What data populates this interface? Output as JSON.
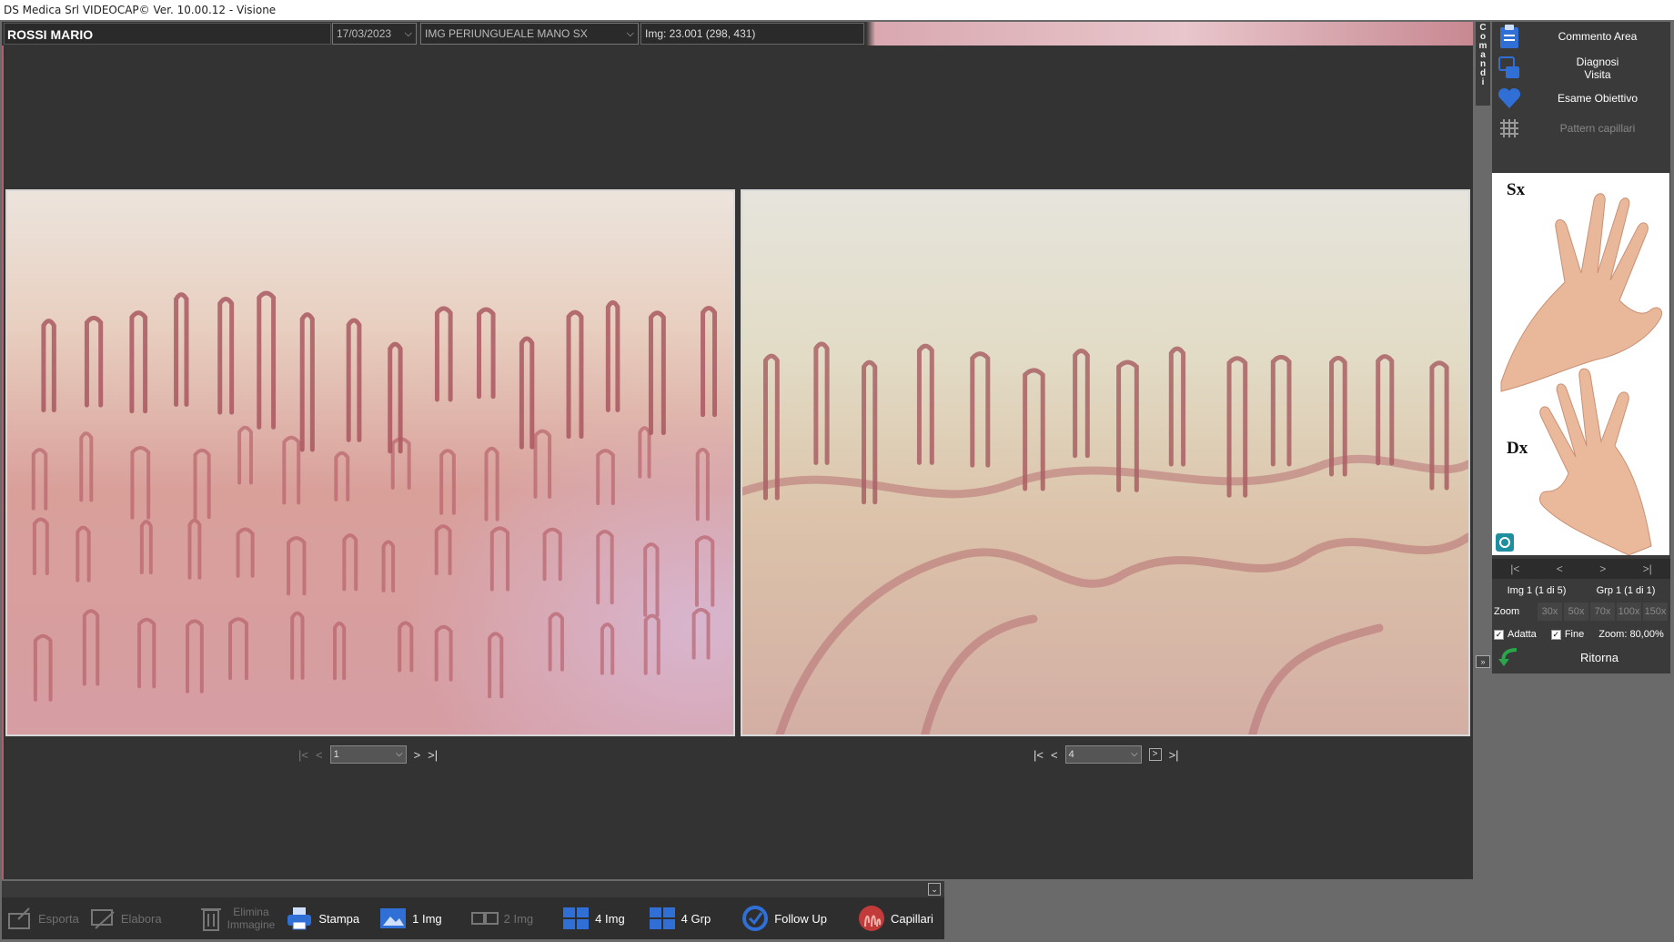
{
  "window": {
    "title": "DS Medica Srl VIDEOCAP© Ver. 10.00.12 - Visione"
  },
  "header": {
    "patient_name": "ROSSI MARIO",
    "date": "17/03/2023",
    "image_type": "IMG PERIUNGUEALE MANO SX",
    "image_info": "Img: 23.001 (298, 431)"
  },
  "left_nav": {
    "first": "|<",
    "prev": "<",
    "selected": "1",
    "next": ">",
    "last": ">|"
  },
  "right_nav": {
    "first": "|<",
    "prev": "<",
    "selected": "4",
    "next": ">",
    "last": ">|"
  },
  "comandi_label": [
    "C",
    "o",
    "m",
    "a",
    "n",
    "d",
    "i"
  ],
  "side_menu": {
    "commento_area": "Commento Area",
    "diagnosi_visita_1": "Diagnosi",
    "diagnosi_visita_2": "Visita",
    "esame_obiettivo": "Esame Obiettivo",
    "pattern_capillari": "Pattern capillari"
  },
  "hands": {
    "sx": "Sx",
    "dx": "Dx"
  },
  "side_nav": {
    "first": "|<",
    "prev": "<",
    "next": ">",
    "last": ">|"
  },
  "side_info": {
    "img": "Img 1 (1 di 5)",
    "grp": "Grp 1 (1 di 1)"
  },
  "zoom": {
    "label": "Zoom",
    "options": [
      "30x",
      "50x",
      "70x",
      "100x",
      "150x"
    ]
  },
  "checks": {
    "adatta": "Adatta",
    "fine": "Fine",
    "zoom_value": "Zoom: 80,00%"
  },
  "ritorna": "Ritorna",
  "toolbar": {
    "esporta": "Esporta",
    "elabora": "Elabora",
    "elimina_1": "Elimina",
    "elimina_2": "Immagine",
    "stampa": "Stampa",
    "one_img": "1 Img",
    "two_img": "2 Img",
    "four_img": "4 Img",
    "four_grp": "4 Grp",
    "follow_up": "Follow Up",
    "capillari": "Capillari"
  },
  "colors": {
    "viewer_bg": "#333333",
    "panel_bg": "#3a3a3a",
    "accent_blue": "#2f6fd6",
    "tissue_left": "#d9a3a3",
    "tissue_right": "#d9c6ad"
  }
}
